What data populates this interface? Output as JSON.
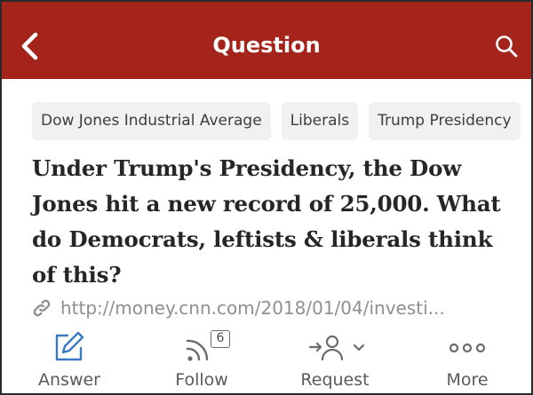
{
  "header": {
    "title": "Question",
    "bg_color": "#a4231b",
    "back_icon": "chevron-left-icon",
    "search_icon": "search-icon"
  },
  "topics": [
    {
      "label": "Dow Jones Industrial Average"
    },
    {
      "label": "Liberals"
    },
    {
      "label": "Trump Presidency"
    }
  ],
  "question": {
    "title": "Under Trump's Presidency, the Dow Jones hit a new record of 25,000. What do Democrats, leftists & liberals think of this?"
  },
  "link": {
    "icon": "link-icon",
    "text": "http://money.cnn.com/2018/01/04/investi..."
  },
  "actions": {
    "answer": {
      "label": "Answer",
      "icon": "pencil-icon",
      "color": "#3a79c2"
    },
    "follow": {
      "label": "Follow",
      "icon": "follow-rss-icon",
      "count": "6"
    },
    "request": {
      "label": "Request",
      "icon": "request-person-icon"
    },
    "more": {
      "label": "More",
      "icon": "more-dots-icon"
    }
  }
}
